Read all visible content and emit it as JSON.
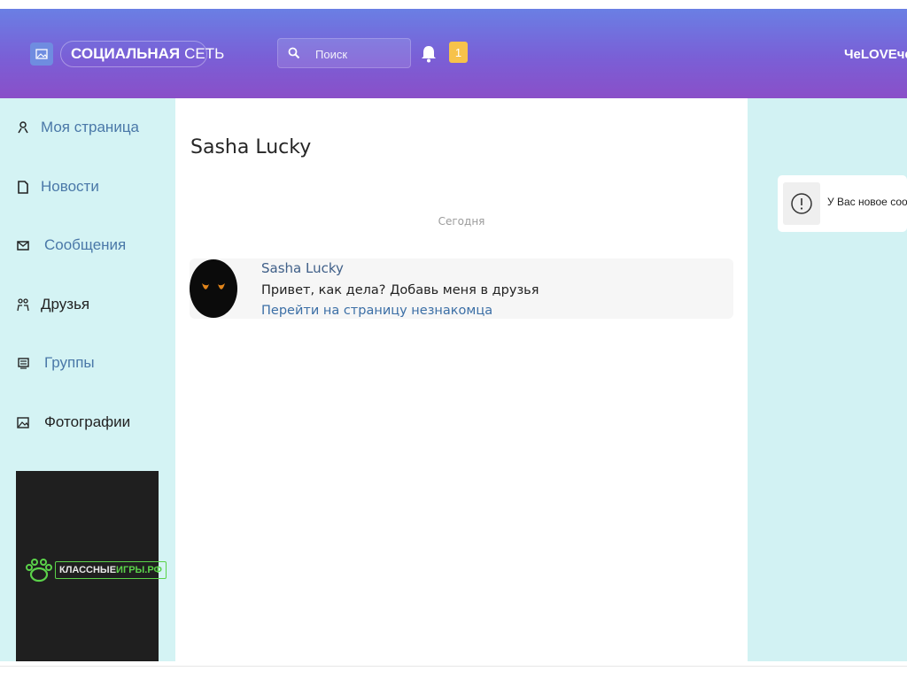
{
  "header": {
    "brand": {
      "bold": "СОЦИАЛЬНАЯ",
      "normal": "СЕТЬ"
    },
    "search_placeholder": "Поиск",
    "notification_count": "1",
    "username": "ЧеLOVEчек"
  },
  "sidebar": {
    "items": [
      {
        "label": "Моя страница",
        "icon": "user-icon",
        "color": "#4a78a8"
      },
      {
        "label": "Новости",
        "icon": "document-icon",
        "color": "#4a78a8"
      },
      {
        "label": "Сообщения",
        "icon": "envelope-icon",
        "color": "#4a78a8"
      },
      {
        "label": "Друзья",
        "icon": "friends-icon",
        "color": "#222222"
      },
      {
        "label": "Группы",
        "icon": "group-icon",
        "color": "#4a78a8"
      },
      {
        "label": "Фотографии",
        "icon": "photo-icon",
        "color": "#222222"
      }
    ],
    "ad_text": {
      "part1": "КЛАССНЫЕ",
      "part2": "ИГРЫ.РФ"
    }
  },
  "chat": {
    "title": "Sasha Lucky",
    "date_separator": "Сегодня",
    "messages": [
      {
        "author": "Sasha Lucky",
        "text": "Привет, как дела? Добавь меня в друзья",
        "link": "Перейти на страницу незнакомца"
      }
    ]
  },
  "notification_toast": {
    "text": "У Вас новое сообщение"
  },
  "colors": {
    "header_gradient_start": "#6a7fe4",
    "header_gradient_end": "#8a4fc8",
    "sidebar_bg": "#d4f3f4",
    "badge": "#f7c24a",
    "link": "#3c6fa6"
  }
}
